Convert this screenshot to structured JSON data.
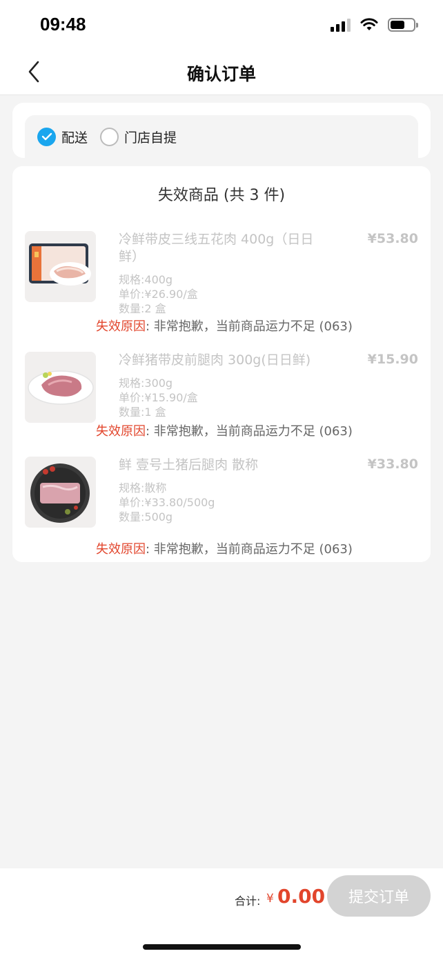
{
  "status_bar": {
    "time": "09:48"
  },
  "nav": {
    "title": "确认订单",
    "back_icon": "chevron-left-icon"
  },
  "delivery": {
    "options": [
      {
        "label": "配送",
        "checked": true
      },
      {
        "label": "门店自提",
        "checked": false
      }
    ]
  },
  "invalid_section": {
    "title": "失效商品 (共 3 件)",
    "reason_label": "失效原因",
    "items": [
      {
        "name": "冷鲜带皮三线五花肉 400g（日日鲜）",
        "price": "¥53.80",
        "spec": "规格:400g",
        "unit_price": "单价:¥26.90/盒",
        "quantity": "数量:2 盒",
        "reason": ": 非常抱歉，当前商品运力不足 (063)"
      },
      {
        "name": "冷鲜猪带皮前腿肉 300g(日日鲜)",
        "price": "¥15.90",
        "spec": "规格:300g",
        "unit_price": "单价:¥15.90/盒",
        "quantity": "数量:1 盒",
        "reason": ": 非常抱歉，当前商品运力不足 (063)"
      },
      {
        "name": "鲜 壹号土猪后腿肉 散称",
        "price": "¥33.80",
        "spec": "规格:散称",
        "unit_price": "单价:¥33.80/500g",
        "quantity": "数量:500g",
        "reason": ": 非常抱歉，当前商品运力不足 (063)"
      }
    ]
  },
  "footer": {
    "total_label": "合计:",
    "currency": "¥",
    "total_amount": "0.00",
    "submit_label": "提交订单"
  },
  "colors": {
    "accent": "#1aa6ee",
    "price_red": "#e2452c",
    "disabled": "#d3d3d3"
  }
}
